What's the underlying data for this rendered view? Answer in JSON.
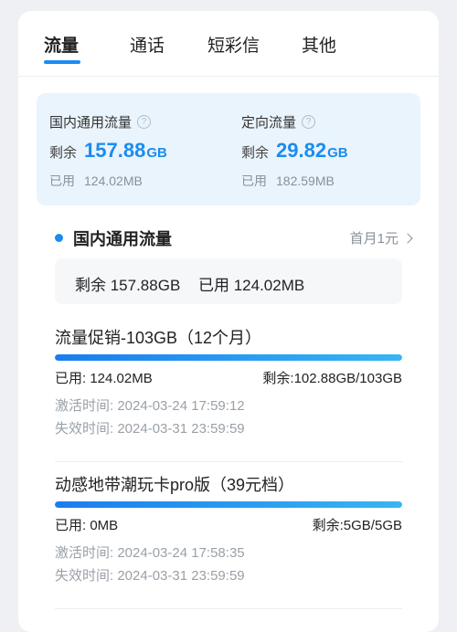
{
  "tabs": [
    {
      "label": "流量",
      "active": true
    },
    {
      "label": "通话",
      "active": false
    },
    {
      "label": "短彩信",
      "active": false
    },
    {
      "label": "其他",
      "active": false
    }
  ],
  "summary": {
    "domestic": {
      "title": "国内通用流量",
      "remain_label": "剩余",
      "remain_value": "157.88",
      "remain_unit": "GB",
      "used_label": "已用",
      "used_value": "124.02MB"
    },
    "directed": {
      "title": "定向流量",
      "remain_label": "剩余",
      "remain_value": "29.82",
      "remain_unit": "GB",
      "used_label": "已用",
      "used_value": "182.59MB"
    }
  },
  "section": {
    "title": "国内通用流量",
    "link": "首月1元",
    "remain_text": "剩余 157.88GB",
    "used_text": "已用 124.02MB"
  },
  "packages": [
    {
      "title": "流量促销-103GB（12个月）",
      "progress": 0.999,
      "used": "已用: 124.02MB",
      "remain": "剩余:102.88GB/103GB",
      "activate_label": "激活时间: ",
      "activate_time": "2024-03-24 17:59:12",
      "expire_label": "失效时间: ",
      "expire_time": "2024-03-31 23:59:59"
    },
    {
      "title": "动感地带潮玩卡pro版（39元档）",
      "progress": 1.0,
      "used": "已用: 0MB",
      "remain": "剩余:5GB/5GB",
      "activate_label": "激活时间: ",
      "activate_time": "2024-03-24 17:58:35",
      "expire_label": "失效时间: ",
      "expire_time": "2024-03-31 23:59:59"
    }
  ],
  "colors": {
    "accent": "#1a8cf0",
    "summary_bg": "#eaf4fc",
    "muted_text": "#9aa0a8"
  }
}
